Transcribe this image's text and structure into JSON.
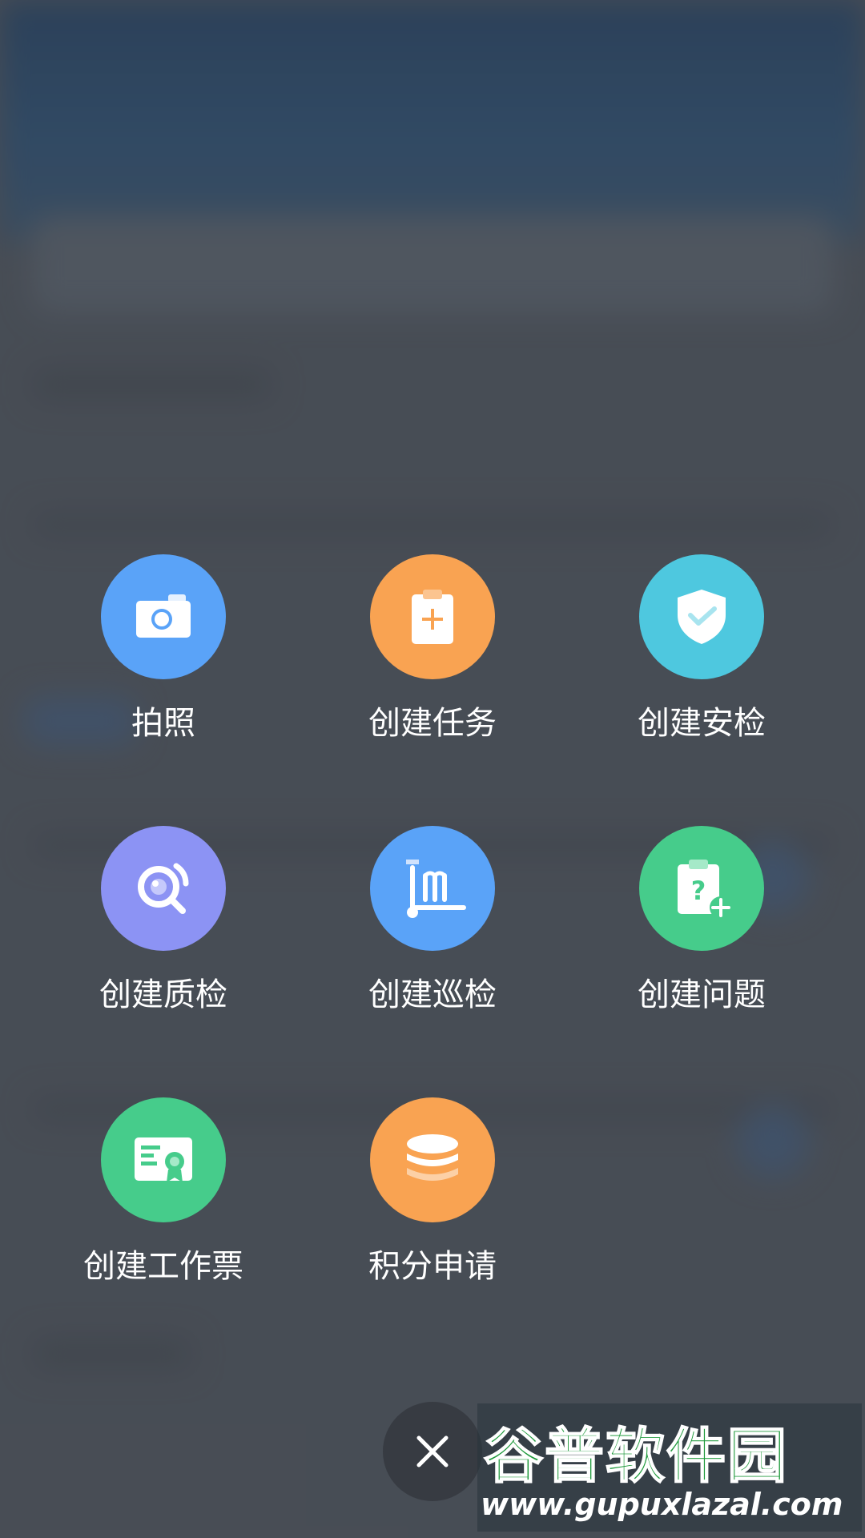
{
  "actions": [
    {
      "label": "拍照",
      "icon": "camera-icon",
      "color": "#5aa3f8"
    },
    {
      "label": "创建任务",
      "icon": "clipboard-plus-icon",
      "color": "#f9a352"
    },
    {
      "label": "创建安检",
      "icon": "shield-check-icon",
      "color": "#4ec8df"
    },
    {
      "label": "创建质检",
      "icon": "magnifier-eye-icon",
      "color": "#8c93f4"
    },
    {
      "label": "创建巡检",
      "icon": "patrol-cart-icon",
      "color": "#5aa3f8"
    },
    {
      "label": "创建问题",
      "icon": "question-clipboard-icon",
      "color": "#46cc8b"
    },
    {
      "label": "创建工作票",
      "icon": "certificate-icon",
      "color": "#46cc8b"
    },
    {
      "label": "积分申请",
      "icon": "coin-stack-icon",
      "color": "#f9a352"
    }
  ],
  "close": {
    "icon": "close-icon"
  },
  "watermark": {
    "title": "谷普软件园",
    "url": "www.gupuxlazal.com"
  }
}
